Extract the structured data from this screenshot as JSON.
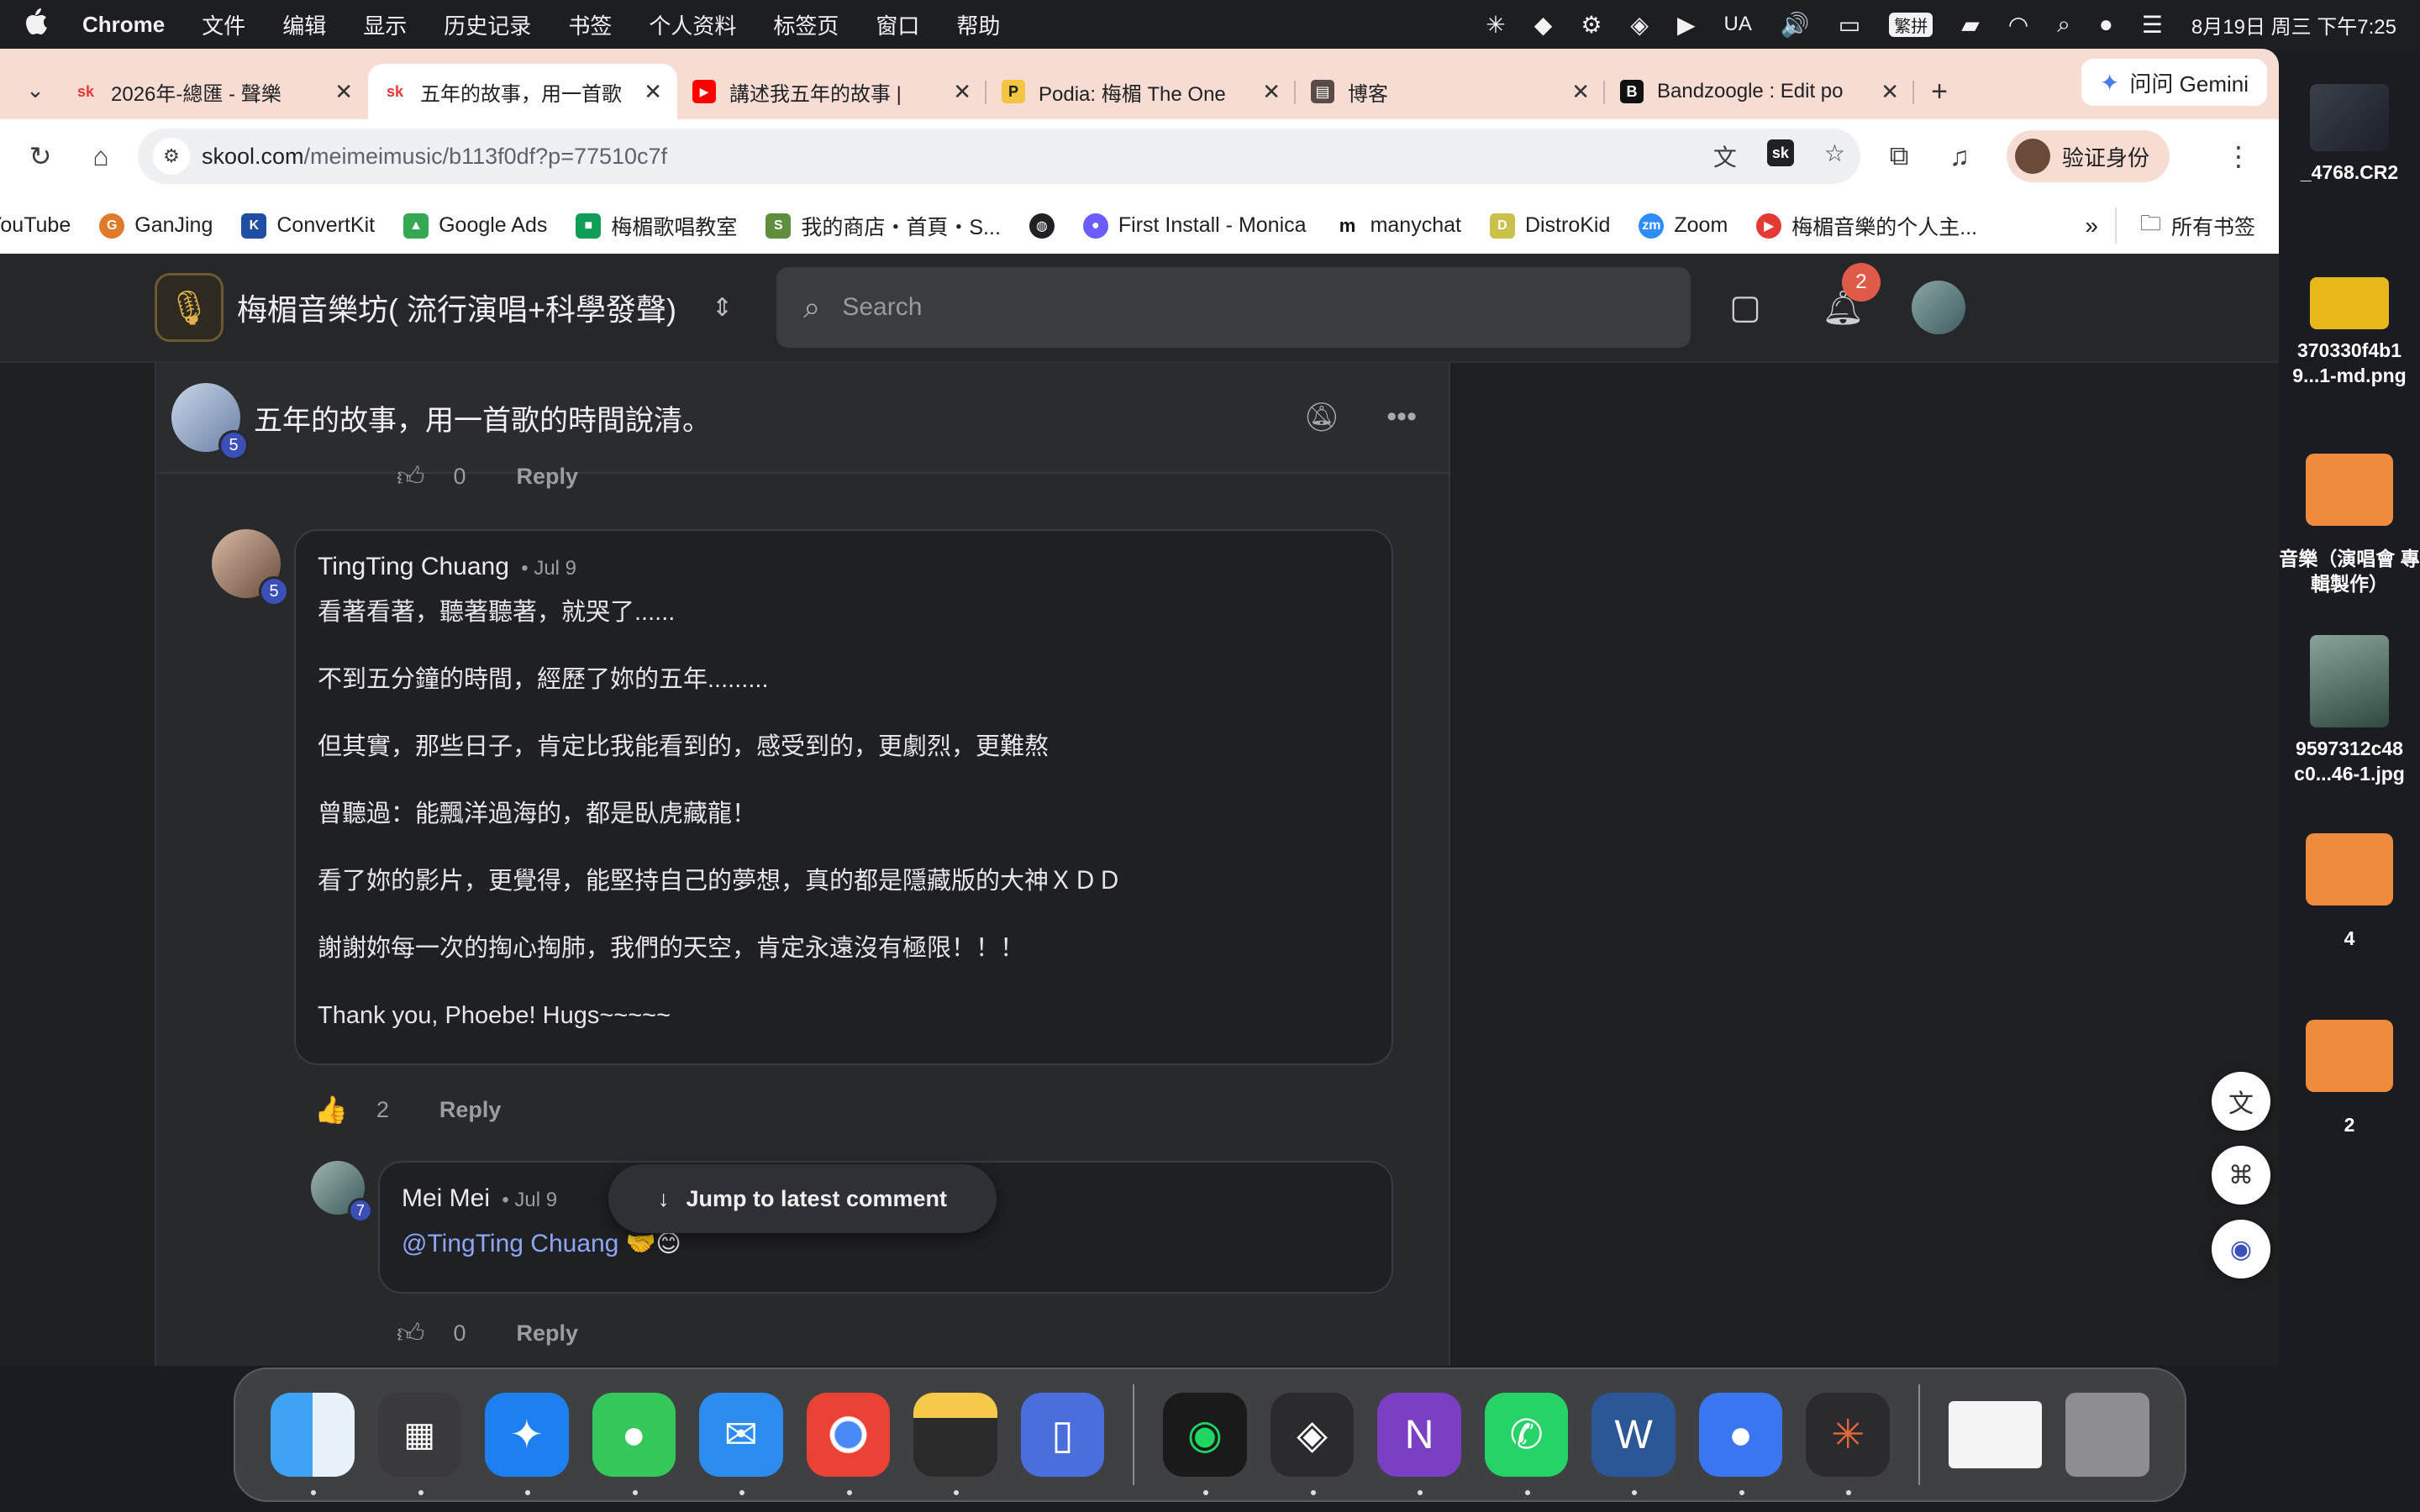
{
  "menubar": {
    "app": "Chrome",
    "items": [
      "文件",
      "编辑",
      "显示",
      "历史记录",
      "书签",
      "个人资料",
      "标签页",
      "窗口",
      "帮助"
    ],
    "status_ua": "UA",
    "input_method": "繁拼",
    "datetime": "8月19日 周三 下午7:25"
  },
  "tabs": [
    {
      "title": "2026年-總匯 - 聲樂",
      "favicon": "sk",
      "active": false
    },
    {
      "title": "五年的故事，用一首歌",
      "favicon": "sk",
      "active": true
    },
    {
      "title": "講述我五年的故事 | ",
      "favicon": "youtube",
      "active": false
    },
    {
      "title": "Podia: 梅楣 The One",
      "favicon": "podia",
      "active": false
    },
    {
      "title": "博客",
      "favicon": "blog",
      "active": false
    },
    {
      "title": "Bandzoogle : Edit po",
      "favicon": "bandzoogle",
      "active": false
    }
  ],
  "gemini_label": "问问 Gemini",
  "address": {
    "host": "skool.com",
    "path": "/meimeimusic/b113f0df?p=77510c7f"
  },
  "verify_label": "验证身份",
  "bookmarks": [
    {
      "label": "YouTube",
      "color": "#ff0000"
    },
    {
      "label": "GanJing",
      "color": "#e07a2a"
    },
    {
      "label": "ConvertKit",
      "color": "#1f4ea3"
    },
    {
      "label": "Google Ads",
      "color": "#34a853"
    },
    {
      "label": "梅楣歌唱教室",
      "color": "#f4b400"
    },
    {
      "label": "我的商店・首頁・S...",
      "color": "#5e8e3e"
    },
    {
      "label": "",
      "color": "#202124"
    },
    {
      "label": "First Install - Monica",
      "color": "#6a5cff"
    },
    {
      "label": "manychat",
      "color": "#111111"
    },
    {
      "label": "DistroKid",
      "color": "#c9c14a"
    },
    {
      "label": "Zoom",
      "color": "#2d8cff"
    },
    {
      "label": "梅楣音樂的个人主...",
      "color": "#e53935"
    }
  ],
  "all_bookmarks_label": "所有书签",
  "skool": {
    "group_name": "梅楣音樂坊( 流行演唱+科學發聲)",
    "search_placeholder": "Search",
    "notification_count": "2",
    "post_title": "五年的故事，用一首歌的時間說清。",
    "author_level": "5",
    "top_action": {
      "likes": "0",
      "reply": "Reply"
    },
    "comment1": {
      "author": "TingTing Chuang",
      "date": "• Jul 9",
      "level": "5",
      "lines": [
        "看著看著，聽著聽著，就哭了......",
        "不到五分鐘的時間，經歷了妳的五年.........",
        "但其實，那些日子，肯定比我能看到的，感受到的，更劇烈，更難熬",
        "曾聽過：能飄洋過海的，都是臥虎藏龍！",
        "看了妳的影片，更覺得，能堅持自己的夢想，真的都是隱藏版的大神ＸＤＤ",
        "謝謝妳每一次的掏心掏肺，我們的天空，肯定永遠沒有極限！！！",
        "Thank you, Phoebe! Hugs~~~~~"
      ],
      "likes": "2",
      "reply": "Reply"
    },
    "comment2": {
      "author": "Mei Mei",
      "date": "• Jul 9",
      "level": "7",
      "mention": "@TingTing Chuang",
      "emoji": "🤝😊",
      "likes": "0",
      "reply": "Reply"
    },
    "jump_label": "Jump to latest comment"
  },
  "desktop": [
    {
      "label": "_4768.CR2"
    },
    {
      "label": "370330f4b1 9...1-md.png"
    },
    {
      "label": "音樂（演唱會 專輯製作）"
    },
    {
      "label": "9597312c48 c0...46-1.jpg"
    },
    {
      "label": "4"
    },
    {
      "label": "2"
    }
  ]
}
